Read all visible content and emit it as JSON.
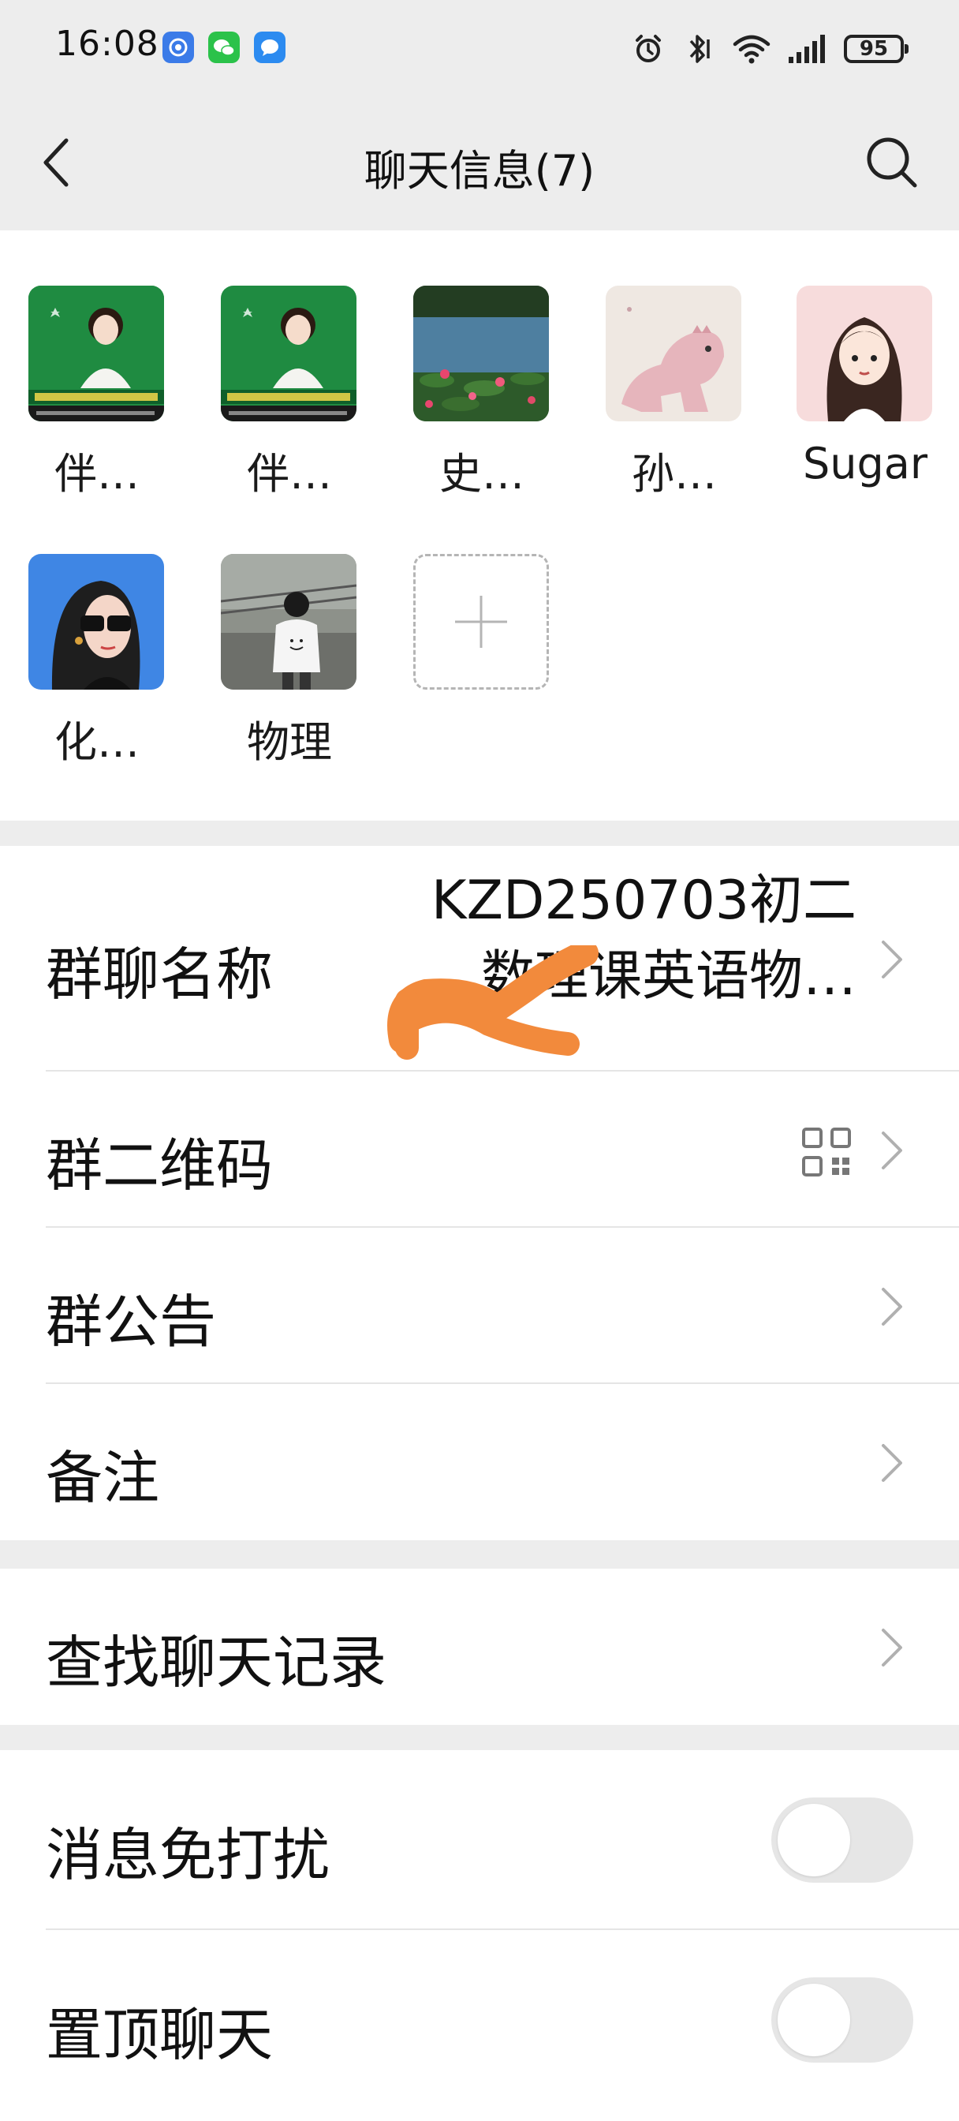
{
  "status_bar": {
    "time": "16:08",
    "battery": "95",
    "app_badges": [
      "blue-app-icon",
      "wechat-icon",
      "message-icon"
    ]
  },
  "nav": {
    "title": "聊天信息(7)"
  },
  "members": [
    {
      "name": "伴…",
      "avatar": "poster-avatar"
    },
    {
      "name": "伴…",
      "avatar": "poster-avatar"
    },
    {
      "name": "史…",
      "avatar": "lotus-pond-avatar"
    },
    {
      "name": "孙…",
      "avatar": "pink-dinosaur-avatar"
    },
    {
      "name": "Sugar",
      "avatar": "cartoon-girl-avatar"
    },
    {
      "name": "化…",
      "avatar": "sunglasses-girl-avatar"
    },
    {
      "name": "物理",
      "avatar": "child-photo-avatar"
    }
  ],
  "settings": {
    "group_name_label": "群聊名称",
    "group_name_value_line1": "KZD250703初二",
    "group_name_value_line2": "数理课英语物…",
    "qr_label": "群二维码",
    "announcement_label": "群公告",
    "remark_label": "备注",
    "search_history_label": "查找聊天记录",
    "mute_label": "消息免打扰",
    "mute_on": false,
    "pin_label": "置顶聊天",
    "pin_on": false
  },
  "colors": {
    "page_bg": "#ededed",
    "cell_bg": "#ffffff",
    "scribble": "#f28a3c",
    "toggle_off": "#e6e6e6"
  }
}
